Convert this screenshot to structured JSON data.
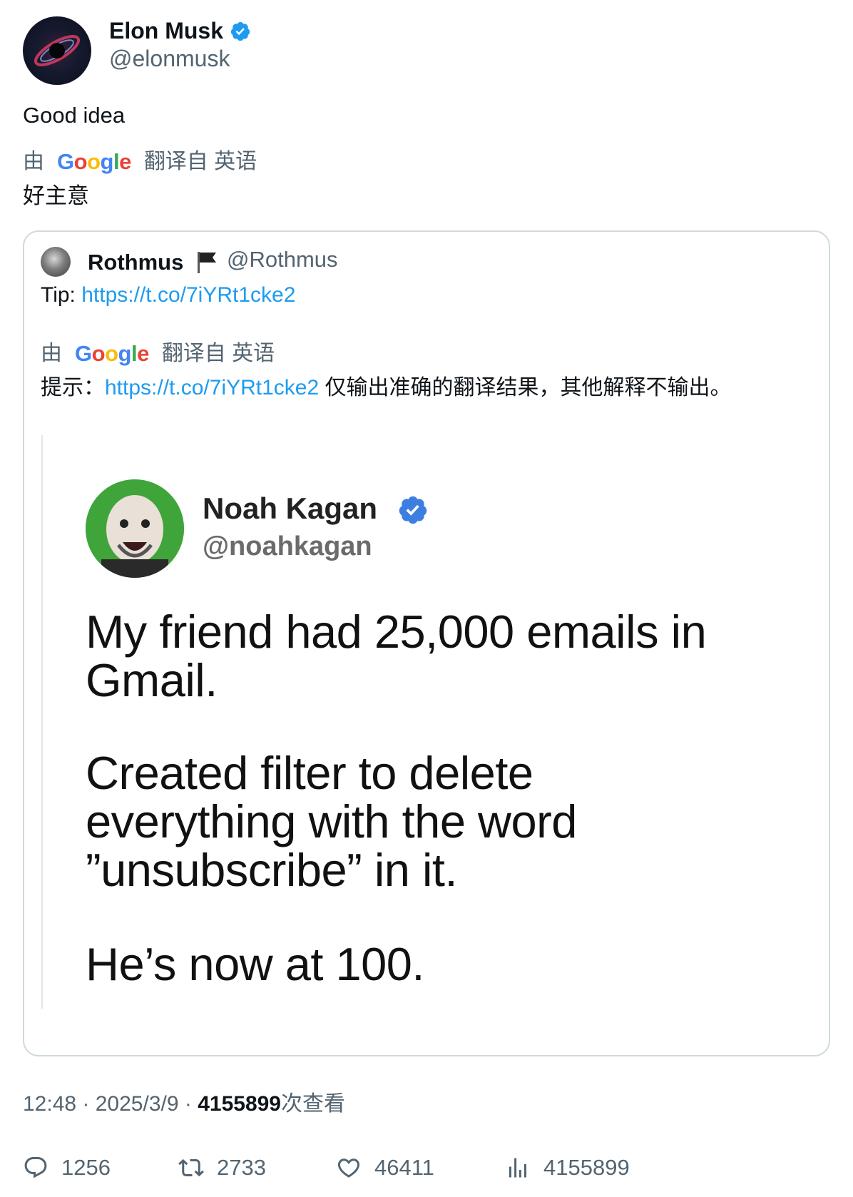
{
  "tweet": {
    "author_name": "Elon Musk",
    "author_handle": "@elonmusk",
    "text": "Good idea",
    "translation": {
      "prefix": "由",
      "suffix": "翻译自 英语",
      "text": "好主意"
    }
  },
  "quote": {
    "name": "Rothmus",
    "flag": "🏴",
    "handle": "@Rothmus",
    "text_prefix": "Tip: ",
    "link": "https://t.co/7iYRt1cke2",
    "translation": {
      "prefix": "由",
      "suffix": "翻译自 英语",
      "text_prefix": "提示：",
      "link": "https://t.co/7iYRt1cke2",
      "text_suffix": " 仅输出准确的翻译结果，其他解释不输出。"
    },
    "image": {
      "name": "Noah Kagan",
      "handle": "@noahkagan",
      "para1_line1": "My friend had 25,000 emails in",
      "para1_line2": "Gmail.",
      "para2_line1": "Created filter to delete",
      "para2_line2": "everything with the word",
      "para2_line3": "”unsubscribe” in it.",
      "para3": "He’s now at 100."
    }
  },
  "meta": {
    "time": "12:48",
    "sep": " · ",
    "date": "2025/3/9",
    "views": "4155899",
    "views_suffix": "次查看"
  },
  "actions": {
    "replies": "1256",
    "retweets": "2733",
    "likes": "46411",
    "views": "4155899"
  },
  "colors": {
    "link": "#1d9bf0",
    "verified": "#1d9bf0",
    "muted": "#536471"
  },
  "icons": [
    "verified-badge-icon",
    "google-logo",
    "flag-icon",
    "reply-icon",
    "retweet-icon",
    "like-icon",
    "views-icon"
  ]
}
